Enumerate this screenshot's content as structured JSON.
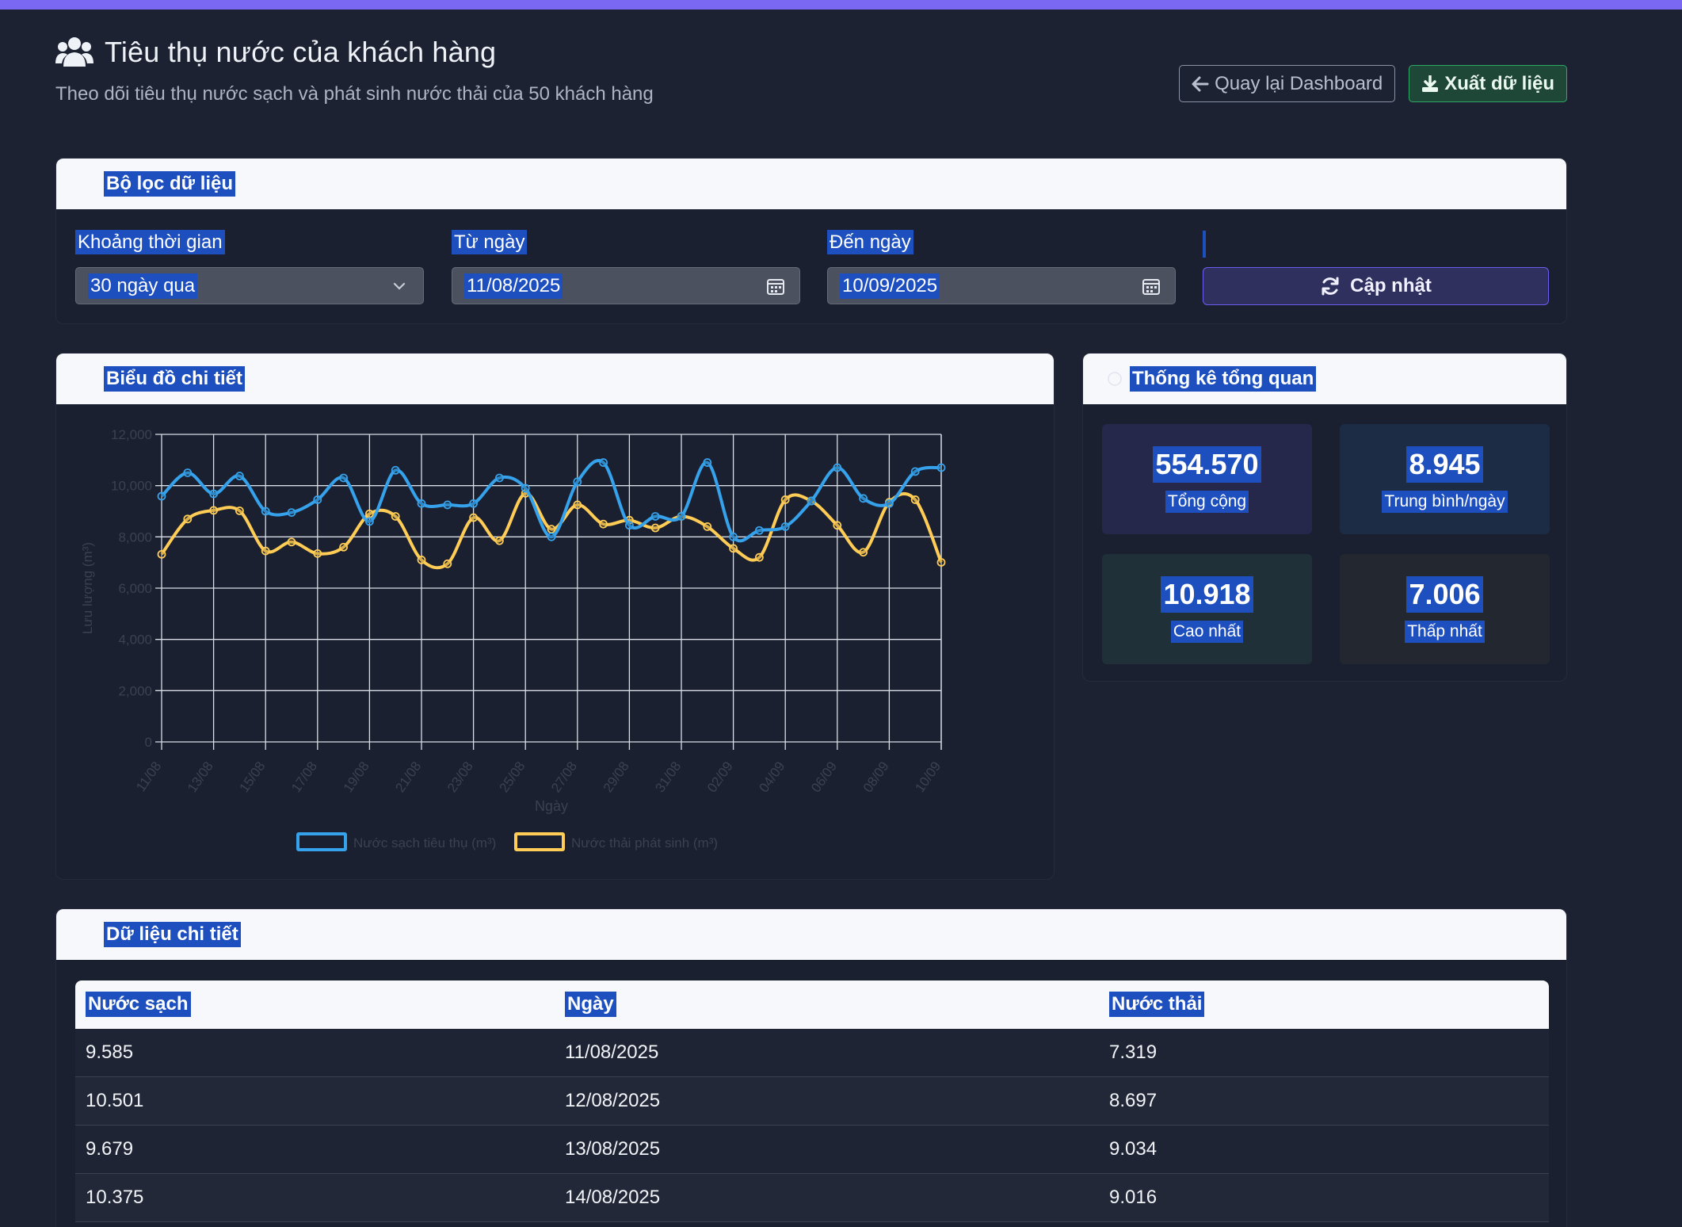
{
  "header": {
    "title": "Tiêu thụ nước của khách hàng",
    "subtitle": "Theo dõi tiêu thụ nước sạch và phát sinh nước thải của 50 khách hàng",
    "back_label": "Quay lại Dashboard",
    "export_label": "Xuất dữ liệu"
  },
  "filter": {
    "title": "Bộ lọc dữ liệu",
    "range_label": "Khoảng thời gian",
    "range_value": "30 ngày qua",
    "from_label": "Từ ngày",
    "from_value": "11/08/2025",
    "to_label": "Đến ngày",
    "to_value": "10/09/2025",
    "update_label": "Cập nhật"
  },
  "chart_card": {
    "title": "Biểu đồ chi tiết"
  },
  "chart_data": {
    "type": "line",
    "xlabel": "Ngày",
    "ylabel": "Lưu lượng (m³)",
    "ylim": [
      0,
      12000
    ],
    "yticks": [
      "0",
      "2,000",
      "4,000",
      "6,000",
      "8,000",
      "10,000",
      "12,000"
    ],
    "tick_labels": [
      "11/08",
      "13/08",
      "15/08",
      "17/08",
      "19/08",
      "21/08",
      "23/08",
      "25/08",
      "27/08",
      "29/08",
      "31/08",
      "02/09",
      "04/09",
      "06/09",
      "08/09",
      "10/09"
    ],
    "x": [
      "11/08",
      "12/08",
      "13/08",
      "14/08",
      "15/08",
      "16/08",
      "17/08",
      "18/08",
      "19/08",
      "20/08",
      "21/08",
      "22/08",
      "23/08",
      "24/08",
      "25/08",
      "26/08",
      "27/08",
      "28/08",
      "29/08",
      "30/08",
      "31/08",
      "01/09",
      "02/09",
      "03/09",
      "04/09",
      "05/09",
      "06/09",
      "07/09",
      "08/09",
      "09/09",
      "10/09"
    ],
    "grid": true,
    "legend_position": "bottom",
    "series": [
      {
        "name": "Nước sạch tiêu thụ (m³)",
        "color": "#36a2eb",
        "values": [
          9585,
          10501,
          9679,
          10375,
          9000,
          8950,
          9450,
          10300,
          8600,
          10600,
          9300,
          9250,
          9300,
          10300,
          9900,
          8000,
          10150,
          10900,
          8450,
          8800,
          8800,
          10900,
          8000,
          8250,
          8400,
          9400,
          10700,
          9500,
          9300,
          10550,
          10700
        ]
      },
      {
        "name": "Nước thải phát sinh (m³)",
        "color": "#ffcd56",
        "values": [
          7319,
          8697,
          9034,
          9016,
          7450,
          7800,
          7350,
          7600,
          8900,
          8800,
          7100,
          6950,
          8750,
          7850,
          9700,
          8300,
          9250,
          8500,
          8650,
          8350,
          8800,
          8400,
          7550,
          7200,
          9450,
          9400,
          8450,
          7400,
          9350,
          9450,
          7006
        ]
      }
    ]
  },
  "stats": {
    "title": "Thống kê tổng quan",
    "total_value": "554.570",
    "total_label": "Tổng cộng",
    "avg_value": "8.945",
    "avg_label": "Trung bình/ngày",
    "max_value": "10.918",
    "max_label": "Cao nhất",
    "min_value": "7.006",
    "min_label": "Thấp nhất"
  },
  "table": {
    "title": "Dữ liệu chi tiết",
    "headers": [
      "Nước sạch",
      "Ngày",
      "Nước thải"
    ],
    "rows": [
      [
        "9.585",
        "11/08/2025",
        "7.319"
      ],
      [
        "10.501",
        "12/08/2025",
        "8.697"
      ],
      [
        "9.679",
        "13/08/2025",
        "9.034"
      ],
      [
        "10.375",
        "14/08/2025",
        "9.016"
      ]
    ]
  },
  "colors": {
    "accent": "#7b68f2",
    "highlight": "#1d4fbf",
    "clean_water": "#36a2eb",
    "waste_water": "#ffcd56",
    "export_green": "#2fa866"
  }
}
